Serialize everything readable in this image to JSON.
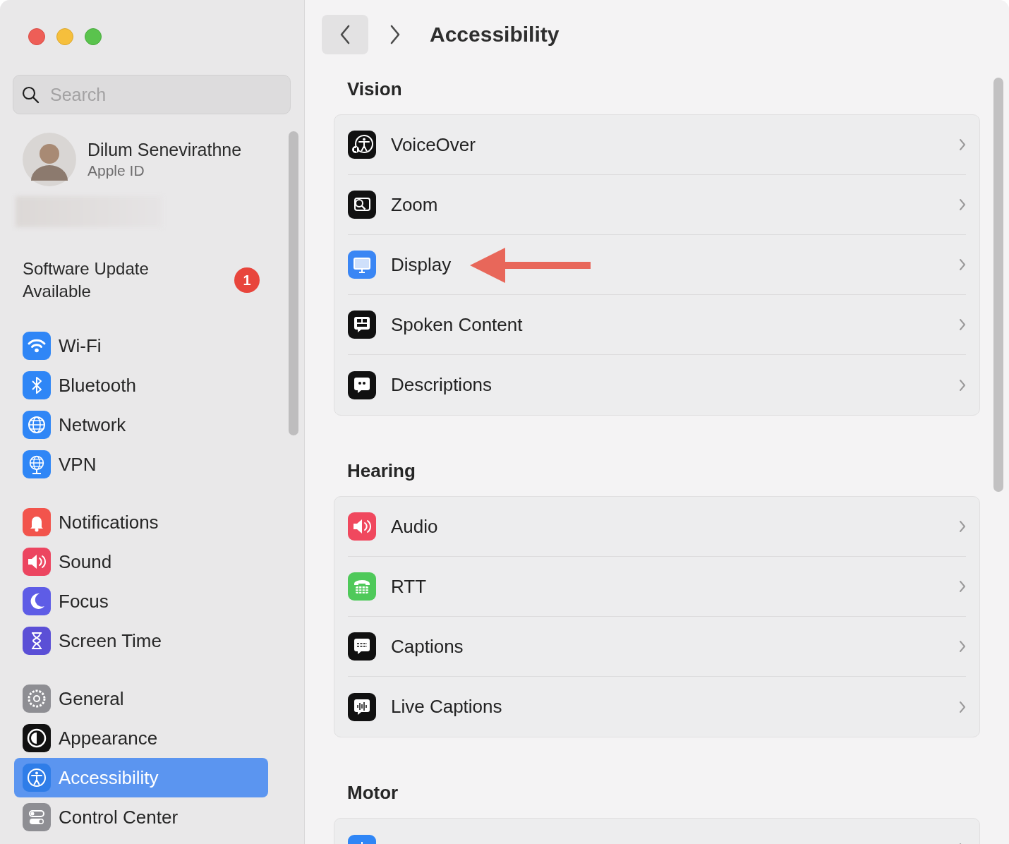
{
  "window": {
    "title": "Accessibility"
  },
  "sidebar": {
    "search": {
      "placeholder": "Search"
    },
    "account": {
      "name": "Dilum Senevirathne",
      "subtitle": "Apple ID"
    },
    "update": {
      "label": "Software Update Available",
      "badge": "1"
    },
    "groups": [
      {
        "items": [
          {
            "label": "Wi-Fi",
            "selected": false
          },
          {
            "label": "Bluetooth",
            "selected": false
          },
          {
            "label": "Network",
            "selected": false
          },
          {
            "label": "VPN",
            "selected": false
          }
        ]
      },
      {
        "items": [
          {
            "label": "Notifications",
            "selected": false
          },
          {
            "label": "Sound",
            "selected": false
          },
          {
            "label": "Focus",
            "selected": false
          },
          {
            "label": "Screen Time",
            "selected": false
          }
        ]
      },
      {
        "items": [
          {
            "label": "General",
            "selected": false
          },
          {
            "label": "Appearance",
            "selected": false
          },
          {
            "label": "Accessibility",
            "selected": true
          },
          {
            "label": "Control Center",
            "selected": false
          }
        ]
      }
    ]
  },
  "sections": [
    {
      "title": "Vision",
      "rows": [
        {
          "label": "VoiceOver",
          "annotated": false
        },
        {
          "label": "Zoom",
          "annotated": false
        },
        {
          "label": "Display",
          "annotated": true
        },
        {
          "label": "Spoken Content",
          "annotated": false
        },
        {
          "label": "Descriptions",
          "annotated": false
        }
      ]
    },
    {
      "title": "Hearing",
      "rows": [
        {
          "label": "Audio",
          "annotated": false
        },
        {
          "label": "RTT",
          "annotated": false
        },
        {
          "label": "Captions",
          "annotated": false
        },
        {
          "label": "Live Captions",
          "annotated": false
        }
      ]
    },
    {
      "title": "Motor",
      "rows": [
        {
          "annotated": false
        }
      ]
    }
  ]
}
